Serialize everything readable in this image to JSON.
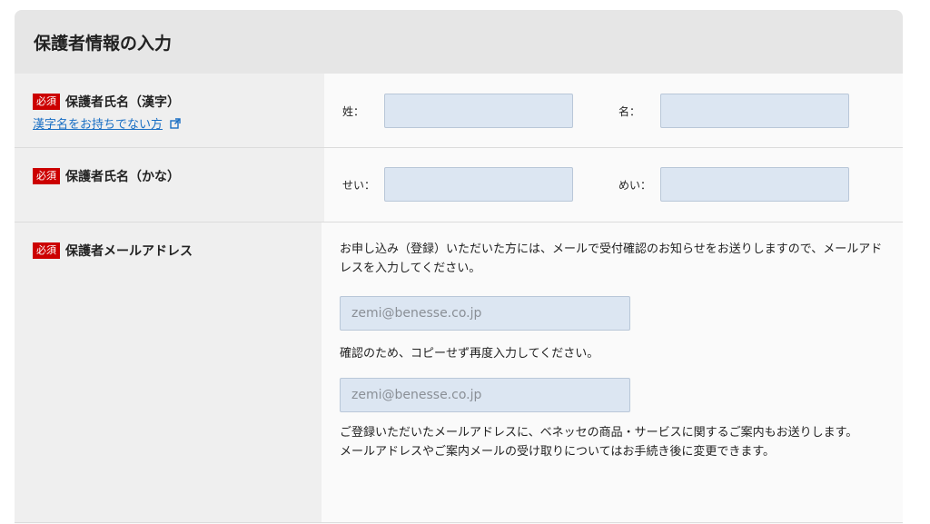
{
  "section": {
    "title": "保護者情報の入力"
  },
  "badge": {
    "required_label": "必須"
  },
  "rows": {
    "kanji": {
      "label": "保護者氏名（漢字）",
      "link": "漢字名をお持ちでない方",
      "sei_label": "姓：",
      "mei_label": "名：",
      "sei_value": "",
      "mei_value": ""
    },
    "kana": {
      "label": "保護者氏名（かな）",
      "sei_label": "せい：",
      "mei_label": "めい：",
      "sei_value": "",
      "mei_value": ""
    },
    "email": {
      "label": "保護者メールアドレス",
      "description": "お申し込み（登録）いただいた方には、メールで受付確認のお知らせをお送りしますので、メールアドレスを入力してください。",
      "email_placeholder": "zemi@benesse.co.jp",
      "confirm_instruction": "確認のため、コピーせず再度入力してください。",
      "confirm_placeholder": "zemi@benesse.co.jp",
      "note_line1": "ご登録いただいたメールアドレスに、ベネッセの商品・サービスに関するご案内もお送りします。",
      "note_line2": "メールアドレスやご案内メールの受け取りについてはお手続き後に変更できます。"
    }
  },
  "colors": {
    "required_badge": "#cc0000",
    "link": "#1a6fc4",
    "input_bg": "#dce6f2",
    "header_bg": "#e6e6e6",
    "label_bg": "#efefef"
  },
  "icons": {
    "external_link": "external-link-icon"
  }
}
